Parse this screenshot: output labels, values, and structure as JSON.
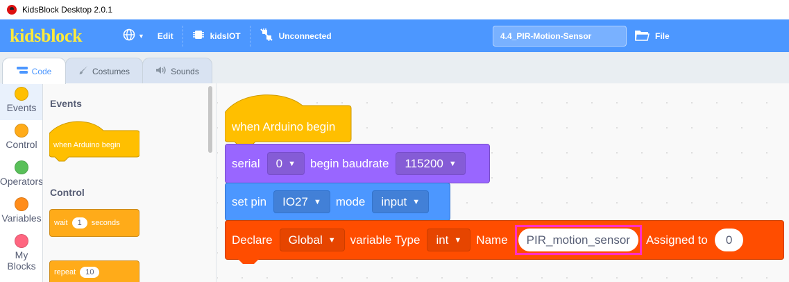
{
  "window": {
    "title": "KidsBlock Desktop 2.0.1"
  },
  "menubar": {
    "logo": "kidsblock",
    "language_icon": "globe-icon",
    "edit_label": "Edit",
    "device_label": "kidsIOT",
    "connection_label": "Unconnected",
    "project_title": "4.4_PIR-Motion-Sensor",
    "file_label": "File",
    "colors": {
      "bar": "#4c97ff",
      "logo": "#ffeb3b"
    }
  },
  "tabs": [
    {
      "label": "Code",
      "icon": "code-icon",
      "active": true
    },
    {
      "label": "Costumes",
      "icon": "brush-icon",
      "active": false
    },
    {
      "label": "Sounds",
      "icon": "speaker-icon",
      "active": false
    }
  ],
  "categories": [
    {
      "label": "Events",
      "color": "#ffbf00",
      "selected": true
    },
    {
      "label": "Control",
      "color": "#ffab19",
      "selected": false
    },
    {
      "label": "Operators",
      "color": "#59c059",
      "selected": false
    },
    {
      "label": "Variables",
      "color": "#ff8c1a",
      "selected": false
    },
    {
      "label": "My Blocks",
      "color": "#ff6680",
      "selected": false
    }
  ],
  "palette": {
    "events_heading": "Events",
    "events_block": "when Arduino begin",
    "control_heading": "Control",
    "wait_block": {
      "prefix": "wait",
      "value": "1",
      "suffix": "seconds"
    },
    "repeat_block": {
      "prefix": "repeat",
      "value": "10"
    }
  },
  "script": {
    "hat": {
      "label": "when Arduino begin",
      "color": "#ffbf00"
    },
    "serial": {
      "label": "serial",
      "port": "0",
      "middle": "begin baudrate",
      "baud": "115200",
      "color": "#9966ff"
    },
    "set_pin": {
      "label": "set pin",
      "pin": "IO27",
      "middle": "mode",
      "mode": "input",
      "color": "#4c97ff"
    },
    "declare": {
      "label": "Declare",
      "scope": "Global",
      "type_label": "variable Type",
      "type": "int",
      "name_label": "Name",
      "name_value": "PIR_motion_sensor",
      "assigned_label": "Assigned to",
      "assigned_value": "0",
      "color": "#ff4d00",
      "highlight": "#ff2fc4"
    }
  }
}
